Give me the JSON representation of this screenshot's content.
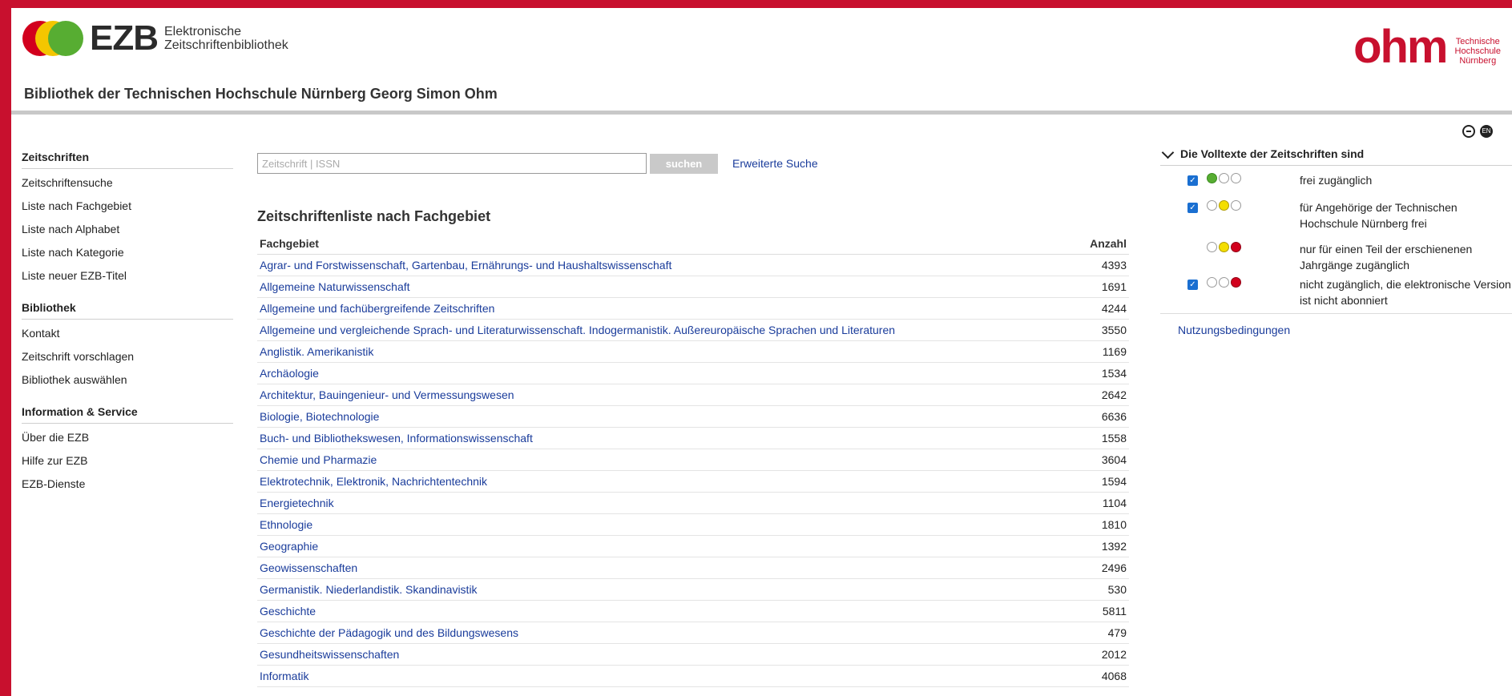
{
  "header": {
    "logo_word": "EZB",
    "logo_sub_line1": "Elektronische",
    "logo_sub_line2": "Zeitschriftenbibliothek",
    "library_title": "Bibliothek der Technischen Hochschule Nürnberg Georg Simon Ohm",
    "partner_word": "ohm",
    "partner_sub_line1": "Technische",
    "partner_sub_line2": "Hochschule",
    "partner_sub_line3": "Nürnberg",
    "lang_label": "EN"
  },
  "sidebar": {
    "groups": [
      {
        "title": "Zeitschriften",
        "items": [
          "Zeitschriftensuche",
          "Liste nach Fachgebiet",
          "Liste nach Alphabet",
          "Liste nach Kategorie",
          "Liste neuer EZB-Titel"
        ]
      },
      {
        "title": "Bibliothek",
        "items": [
          "Kontakt",
          "Zeitschrift vorschlagen",
          "Bibliothek auswählen"
        ]
      },
      {
        "title": "Information & Service",
        "items": [
          "Über die EZB",
          "Hilfe zur EZB",
          "EZB-Dienste"
        ]
      }
    ]
  },
  "search": {
    "placeholder": "Zeitschrift | ISSN",
    "button_label": "suchen",
    "advanced_label": "Erweiterte Suche"
  },
  "list": {
    "title": "Zeitschriftenliste nach Fachgebiet",
    "col_subject": "Fachgebiet",
    "col_count": "Anzahl",
    "rows": [
      {
        "subject": "Agrar- und Forstwissenschaft, Gartenbau, Ernährungs- und Haushaltswissenschaft",
        "count": "4393"
      },
      {
        "subject": "Allgemeine Naturwissenschaft",
        "count": "1691"
      },
      {
        "subject": "Allgemeine und fachübergreifende Zeitschriften",
        "count": "4244"
      },
      {
        "subject": "Allgemeine und vergleichende Sprach- und Literaturwissenschaft. Indogermanistik. Außereuropäische Sprachen und Literaturen",
        "count": "3550"
      },
      {
        "subject": "Anglistik. Amerikanistik",
        "count": "1169"
      },
      {
        "subject": "Archäologie",
        "count": "1534"
      },
      {
        "subject": "Architektur, Bauingenieur- und Vermessungswesen",
        "count": "2642"
      },
      {
        "subject": "Biologie, Biotechnologie",
        "count": "6636"
      },
      {
        "subject": "Buch- und Bibliothekswesen, Informationswissenschaft",
        "count": "1558"
      },
      {
        "subject": "Chemie und Pharmazie",
        "count": "3604"
      },
      {
        "subject": "Elektrotechnik, Elektronik, Nachrichtentechnik",
        "count": "1594"
      },
      {
        "subject": "Energietechnik",
        "count": "1104"
      },
      {
        "subject": "Ethnologie",
        "count": "1810"
      },
      {
        "subject": "Geographie",
        "count": "1392"
      },
      {
        "subject": "Geowissenschaften",
        "count": "2496"
      },
      {
        "subject": "Germanistik. Niederlandistik. Skandinavistik",
        "count": "530"
      },
      {
        "subject": "Geschichte",
        "count": "5811"
      },
      {
        "subject": "Geschichte der Pädagogik und des Bildungswesens",
        "count": "479"
      },
      {
        "subject": "Gesundheitswissenschaften",
        "count": "2012"
      },
      {
        "subject": "Informatik",
        "count": "4068"
      }
    ]
  },
  "legend": {
    "title": "Die Volltexte der Zeitschriften sind",
    "items": [
      {
        "lines": [
          "frei zugänglich"
        ],
        "lights": [
          "green",
          "off",
          "off"
        ],
        "checked": true
      },
      {
        "lines": [
          "für Angehörige der Technischen",
          "Hochschule Nürnberg frei"
        ],
        "lights": [
          "off",
          "yellow",
          "off"
        ],
        "checked": true
      },
      {
        "lines": [
          "nur für einen Teil der erschienenen",
          "Jahrgänge zugänglich"
        ],
        "lights": [
          "off",
          "yellow",
          "red"
        ],
        "checked": false
      },
      {
        "lines": [
          "nicht zugänglich, die elektronische Version",
          "ist nicht abonniert"
        ],
        "lights": [
          "off",
          "off",
          "red"
        ],
        "checked": true
      }
    ],
    "terms_link": "Nutzungsbedingungen"
  },
  "colors": {
    "frame_red": "#c8102e",
    "link_blue": "#1a3c9b",
    "checkbox_blue": "#1a6fd1"
  }
}
